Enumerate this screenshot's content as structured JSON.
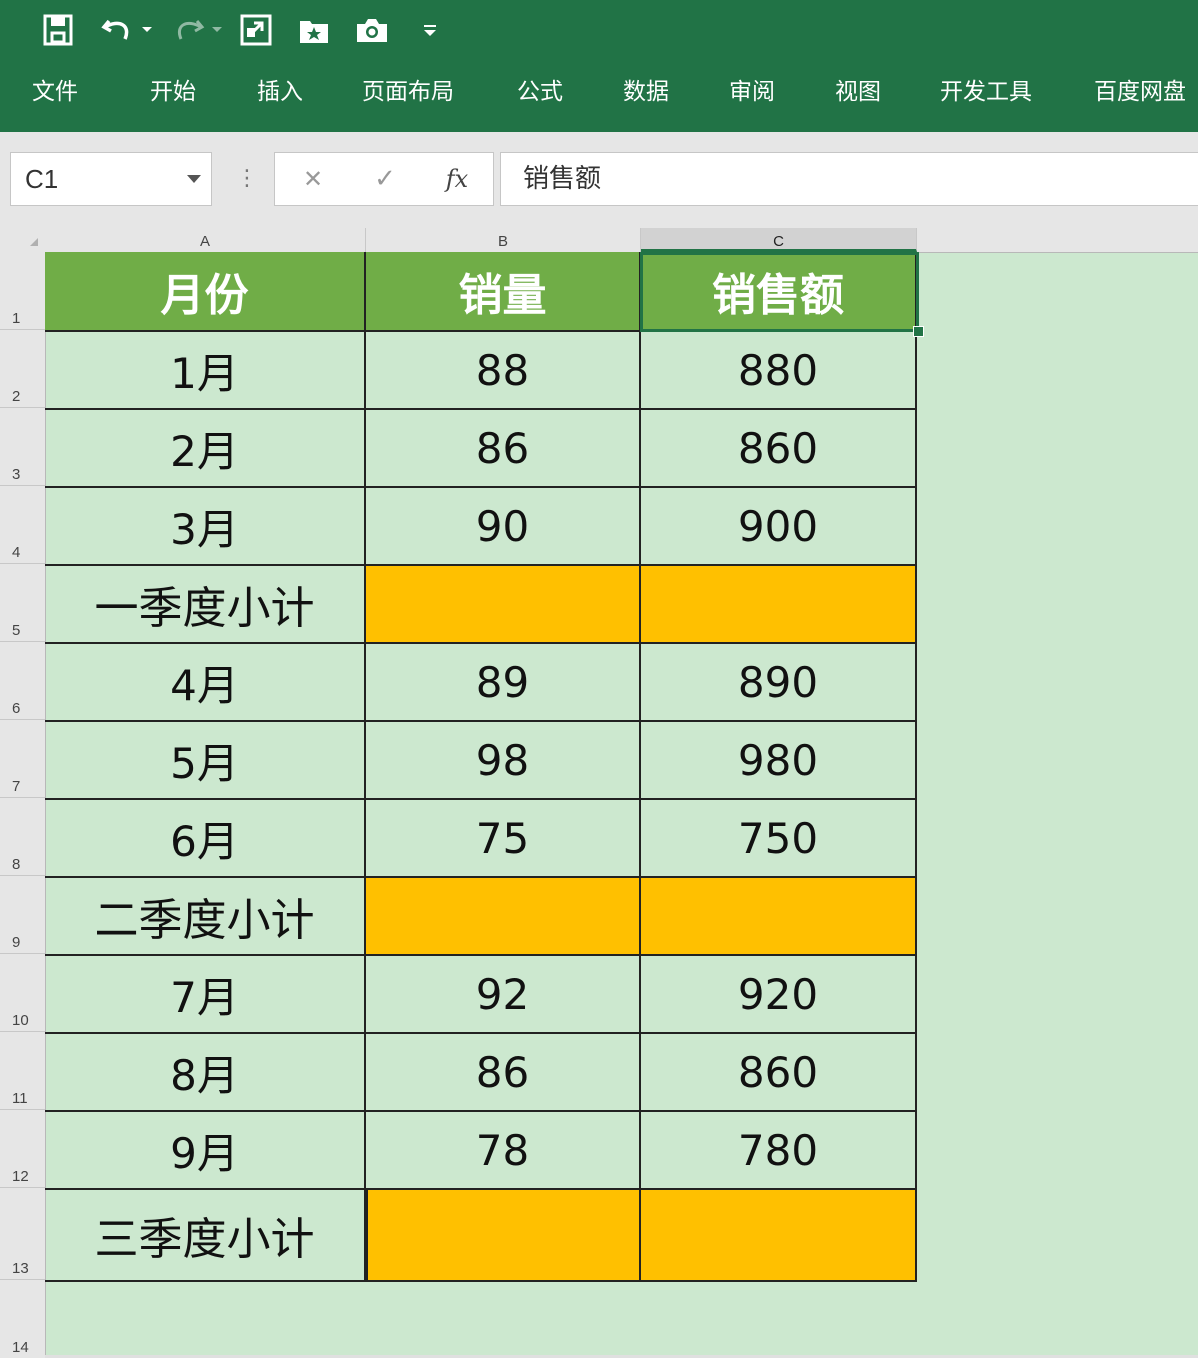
{
  "quick_access": {
    "icons": [
      "save-icon",
      "undo-icon",
      "redo-icon",
      "image-export-icon",
      "star-folder-icon",
      "camera-icon",
      "customize-dropdown-icon"
    ]
  },
  "menu": {
    "items": [
      "文件",
      "开始",
      "插入",
      "页面布局",
      "公式",
      "数据",
      "审阅",
      "视图",
      "开发工具",
      "百度网盘"
    ]
  },
  "formula_bar": {
    "name_box": "C1",
    "cancel_symbol": "✕",
    "enter_symbol": "✓",
    "fx_label": "fx",
    "content": "销售额"
  },
  "sheet": {
    "columns": [
      "A",
      "B",
      "C"
    ],
    "selected_column": "C",
    "selected_cell": "C1",
    "row_numbers": [
      "1",
      "2",
      "3",
      "4",
      "5",
      "6",
      "7",
      "8",
      "9",
      "10",
      "11",
      "12",
      "13",
      "14"
    ],
    "header": [
      "月份",
      "销量",
      "销售额"
    ],
    "rows": [
      {
        "month": "1月",
        "qty": "88",
        "sales": "880",
        "subtotal": false
      },
      {
        "month": "2月",
        "qty": "86",
        "sales": "860",
        "subtotal": false
      },
      {
        "month": "3月",
        "qty": "90",
        "sales": "900",
        "subtotal": false
      },
      {
        "month": "一季度小计",
        "qty": "",
        "sales": "",
        "subtotal": true
      },
      {
        "month": "4月",
        "qty": "89",
        "sales": "890",
        "subtotal": false
      },
      {
        "month": "5月",
        "qty": "98",
        "sales": "980",
        "subtotal": false
      },
      {
        "month": "6月",
        "qty": "75",
        "sales": "750",
        "subtotal": false
      },
      {
        "month": "二季度小计",
        "qty": "",
        "sales": "",
        "subtotal": true
      },
      {
        "month": "7月",
        "qty": "92",
        "sales": "920",
        "subtotal": false
      },
      {
        "month": "8月",
        "qty": "86",
        "sales": "860",
        "subtotal": false
      },
      {
        "month": "9月",
        "qty": "78",
        "sales": "780",
        "subtotal": false
      },
      {
        "month": "三季度小计",
        "qty": "",
        "sales": "",
        "subtotal": true
      }
    ]
  },
  "colors": {
    "ribbon": "#217346",
    "header_fill": "#70ad47",
    "subtotal_fill": "#ffc000",
    "sheet_background": "#cce8cf"
  }
}
